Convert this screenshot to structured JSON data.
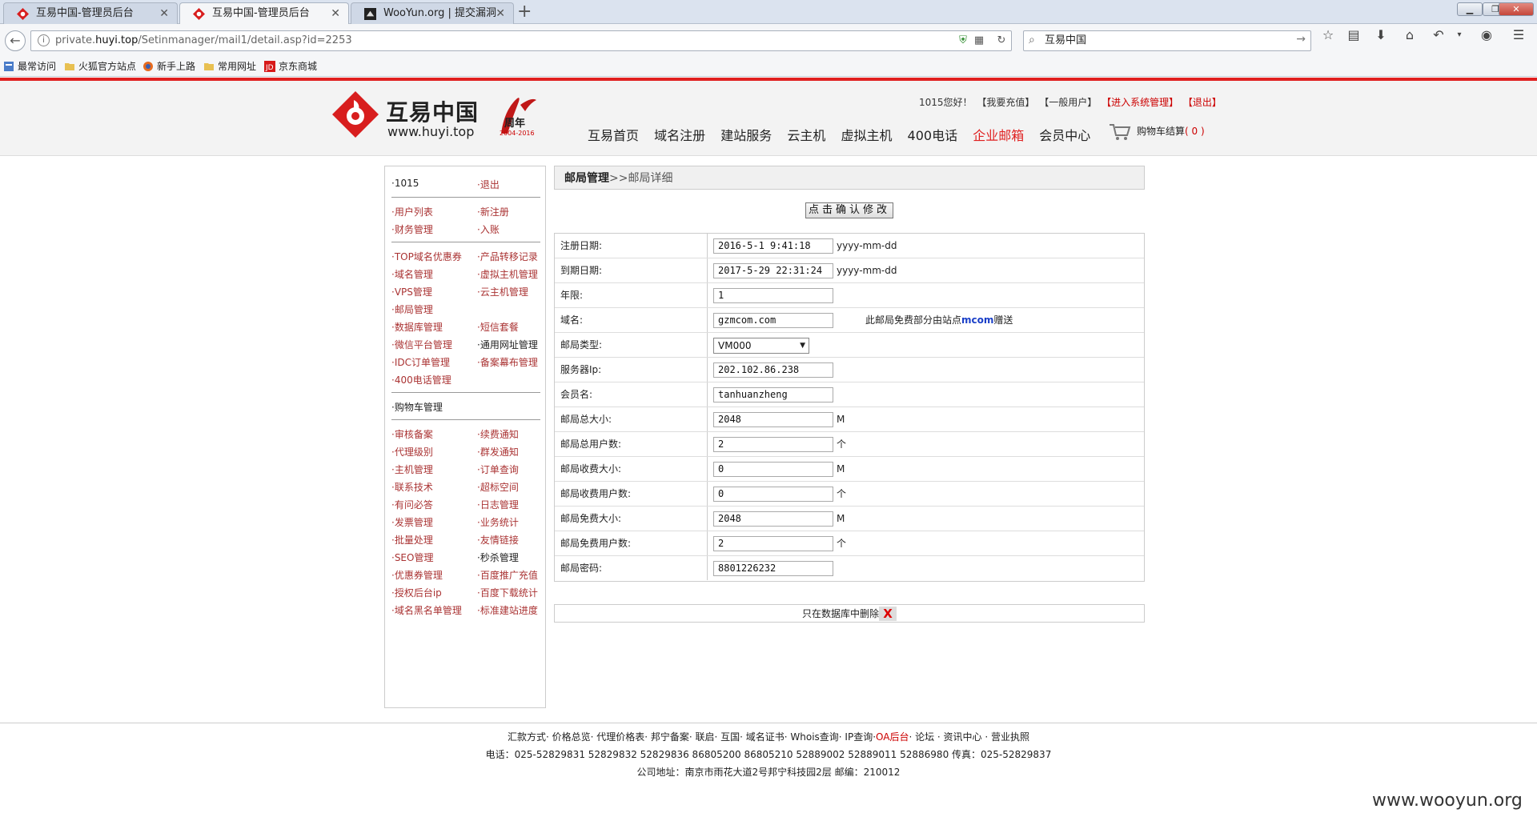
{
  "browser": {
    "tabs": [
      {
        "title": "互易中国-管理员后台",
        "active": false
      },
      {
        "title": "互易中国-管理员后台",
        "active": true
      },
      {
        "title": "WooYun.org | 提交漏洞",
        "active": false
      }
    ],
    "url_prefix": "private.",
    "url_host": "huyi.top",
    "url_path": "/Setinmanager/mail1/detail.asp?id=2253",
    "search_value": "互易中国",
    "bookmarks": [
      "最常访问",
      "火狐官方站点",
      "新手上路",
      "常用网址",
      "京东商城"
    ]
  },
  "header": {
    "logo_text": "互易中国",
    "logo_url": "www.huyi.top",
    "anniv_text": "周年",
    "anniv_years": "2004-2016",
    "greeting": "1015您好！",
    "links": [
      "【我要充值】",
      "【一般用户】",
      "【进入系统管理】",
      "【退出】"
    ],
    "nav": [
      "互易首页",
      "域名注册",
      "建站服务",
      "云主机",
      "虚拟主机",
      "400电话",
      "企业邮箱",
      "会员中心"
    ],
    "nav_current": "企业邮箱",
    "cart_label": "购物车结算",
    "cart_count": "( 0 )"
  },
  "sidebar": {
    "groups": [
      [
        [
          "·1015",
          "·退出"
        ]
      ],
      [
        [
          "·用户列表",
          "·新注册"
        ],
        [
          "·财务管理",
          "·入账"
        ]
      ],
      [
        [
          "·TOP域名优惠券",
          "·产品转移记录"
        ],
        [
          "·域名管理",
          "·虚拟主机管理"
        ],
        [
          "·VPS管理",
          "·云主机管理"
        ],
        [
          "·邮局管理",
          ""
        ],
        [
          "·数据库管理",
          "·短信套餐"
        ],
        [
          "·微信平台管理",
          "·通用网址管理"
        ],
        [
          "·IDC订单管理",
          "·备案幕布管理"
        ],
        [
          "·400电话管理",
          ""
        ]
      ],
      [
        [
          "·购物车管理",
          ""
        ]
      ],
      [
        [
          "·审核备案",
          "·续费通知"
        ],
        [
          "·代理级别",
          "·群发通知"
        ],
        [
          "·主机管理",
          "·订单查询"
        ],
        [
          "·联系技术",
          "·超标空间"
        ],
        [
          "·有问必答",
          "·日志管理"
        ],
        [
          "·发票管理",
          "·业务统计"
        ],
        [
          "·批量处理",
          "·友情链接"
        ],
        [
          "·SEO管理",
          "·秒杀管理"
        ],
        [
          "·优惠券管理",
          "·百度推广充值"
        ],
        [
          "·授权后台ip",
          "·百度下载统计"
        ],
        [
          "·域名黑名单管理",
          "·标准建站进度"
        ]
      ]
    ]
  },
  "content": {
    "title_main": "邮局管理",
    "title_sep": ">>",
    "title_sub": "邮局详细",
    "confirm_label": "点击确认修改",
    "fields": [
      {
        "label": "注册日期:",
        "value": "2016-5-1 9:41:18",
        "suffix": "yyyy-mm-dd"
      },
      {
        "label": "到期日期:",
        "value": "2017-5-29 22:31:24",
        "suffix": "yyyy-mm-dd"
      },
      {
        "label": "年限:",
        "value": "1",
        "suffix": ""
      },
      {
        "label": "域名:",
        "value": "gzmcom.com",
        "suffix": ""
      },
      {
        "label": "邮局类型:",
        "value": "VM000",
        "suffix": ""
      },
      {
        "label": "服务器Ip:",
        "value": "202.102.86.238",
        "suffix": ""
      },
      {
        "label": "会员名:",
        "value": "tanhuanzheng",
        "suffix": ""
      },
      {
        "label": "邮局总大小:",
        "value": "2048",
        "suffix": "M"
      },
      {
        "label": "邮局总用户数:",
        "value": "2",
        "suffix": "个"
      },
      {
        "label": "邮局收费大小:",
        "value": "0",
        "suffix": "M"
      },
      {
        "label": "邮局收费用户数:",
        "value": "0",
        "suffix": "个"
      },
      {
        "label": "邮局免费大小:",
        "value": "2048",
        "suffix": "M"
      },
      {
        "label": "邮局免费用户数:",
        "value": "2",
        "suffix": "个"
      },
      {
        "label": "邮局密码:",
        "value": "8801226232",
        "suffix": ""
      }
    ],
    "domain_note_prefix": "此邮局免费部分由站点",
    "domain_note_site": "mcom",
    "domain_note_suffix": "赠送",
    "delete_label": "只在数据库中删除",
    "delete_icon": "X"
  },
  "footer": {
    "links_before": "汇款方式· 价格总览· 代理价格表· 邦宁备案· 联启· 互国· 域名证书· Whois查询· IP查询·",
    "oa": "OA后台",
    "links_after": "· 论坛 · 资讯中心 · 营业执照",
    "phone": "电话：025-52829831 52829832 52829836 86805200 86805210 52889002 52889011 52886980   传真：025-52829837",
    "address": "公司地址：南京市雨花大道2号邦宁科技园2层 邮编：210012"
  },
  "watermark": "www.wooyun.org",
  "colors": {
    "accent_red": "#e02020",
    "sidebar_link": "#a33333",
    "note_blue": "#1a3fc8"
  }
}
